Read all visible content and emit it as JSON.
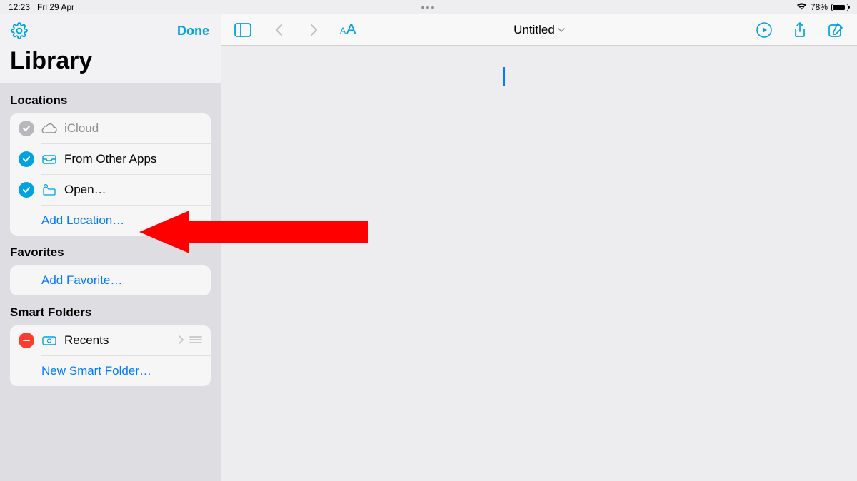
{
  "statusbar": {
    "time": "12:23",
    "date": "Fri 29 Apr",
    "battery_pct": "78%"
  },
  "sidebar": {
    "done_label": "Done",
    "title": "Library",
    "sections": {
      "locations": {
        "header": "Locations",
        "items": [
          {
            "label": "iCloud",
            "checked": false
          },
          {
            "label": "From Other Apps",
            "checked": true
          },
          {
            "label": "Open…",
            "checked": true
          }
        ],
        "add_label": "Add Location…"
      },
      "favorites": {
        "header": "Favorites",
        "add_label": "Add Favorite…"
      },
      "smart_folders": {
        "header": "Smart Folders",
        "items": [
          {
            "label": "Recents"
          }
        ],
        "add_label": "New Smart Folder…"
      }
    }
  },
  "toolbar": {
    "doc_title": "Untitled"
  },
  "colors": {
    "accent": "#00a3e0",
    "link": "#007aff",
    "danger": "#ff3b30"
  }
}
